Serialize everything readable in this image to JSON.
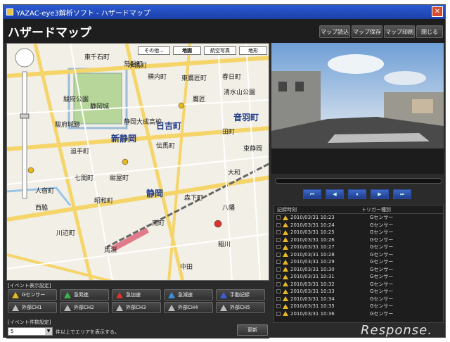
{
  "window": {
    "title": "YAZAC-eye3解析ソフト - ハザードマップ",
    "close_glyph": "✕"
  },
  "header": {
    "title": "ハザードマップ",
    "buttons": [
      "マップ読込",
      "マップ保存",
      "マップ印刷",
      "閉じる"
    ]
  },
  "map": {
    "tabs": [
      "その他...",
      "地図",
      "航空写真",
      "地形"
    ],
    "labels": {
      "a": "東千石町",
      "b": "水落町",
      "c": "横内町",
      "d": "東鷹匠町",
      "e": "春日町",
      "f": "静岡城",
      "g": "駿府公園",
      "h": "駿府城跡",
      "i": "静岡大成高校",
      "j": "新静岡",
      "k": "日吉町",
      "l": "音羽町",
      "m": "静岡",
      "n": "伝馬町",
      "o": "常磐町",
      "p": "昭和町",
      "q": "人宿町",
      "r": "紺屋町",
      "s": "南町",
      "t": "八幡",
      "u": "川辺町",
      "v": "西脇",
      "w": "森下町",
      "x": "中田",
      "y": "馬淵",
      "z": "稲川",
      "aa": "大和",
      "ab": "東静岡",
      "ac": "七間町",
      "ad": "追手町",
      "ae": "鷹匠",
      "af": "田町",
      "ag": "清水山公園"
    }
  },
  "video": {
    "controls": [
      "⏮",
      "◀",
      "⏸",
      "▶",
      "⏭"
    ]
  },
  "event_list": {
    "headers": [
      "記録時刻",
      "トリガー種別"
    ],
    "rows": [
      {
        "time": "2010/03/31 10:23",
        "trigger": "Gセンサー"
      },
      {
        "time": "2010/03/31 10:24",
        "trigger": "Gセンサー"
      },
      {
        "time": "2010/03/31 10:25",
        "trigger": "Gセンサー"
      },
      {
        "time": "2010/03/31 10:26",
        "trigger": "Gセンサー"
      },
      {
        "time": "2010/03/31 10:27",
        "trigger": "Gセンサー"
      },
      {
        "time": "2010/03/31 10:28",
        "trigger": "Gセンサー"
      },
      {
        "time": "2010/03/31 10:29",
        "trigger": "Gセンサー"
      },
      {
        "time": "2010/03/31 10:30",
        "trigger": "Gセンサー"
      },
      {
        "time": "2010/03/31 10:31",
        "trigger": "Gセンサー"
      },
      {
        "time": "2010/03/31 10:32",
        "trigger": "Gセンサー"
      },
      {
        "time": "2010/03/31 10:33",
        "trigger": "Gセンサー"
      },
      {
        "time": "2010/03/31 10:34",
        "trigger": "Gセンサー"
      },
      {
        "time": "2010/03/31 10:35",
        "trigger": "Gセンサー"
      },
      {
        "time": "2010/03/31 10:36",
        "trigger": "Gセンサー"
      }
    ]
  },
  "event_display": {
    "label": "[イベント表示設定]",
    "buttons": [
      {
        "label": "Gセンサー",
        "color": "#e6b820"
      },
      {
        "label": "急発進",
        "color": "#3ab54a"
      },
      {
        "label": "急加速",
        "color": "#d8332c"
      },
      {
        "label": "急減速",
        "color": "#3a8fd8"
      },
      {
        "label": "手動記録",
        "color": "#3a5fd8"
      },
      {
        "label": "外部CH1",
        "color": "#bbbbbb"
      },
      {
        "label": "外部CH2",
        "color": "#bbbbbb"
      },
      {
        "label": "外部CH3",
        "color": "#bbbbbb"
      },
      {
        "label": "外部CH4",
        "color": "#bbbbbb"
      },
      {
        "label": "外部CH5",
        "color": "#bbbbbb"
      }
    ]
  },
  "event_count": {
    "label": "[イベント件数設定]",
    "value": "5",
    "note": "件以上でエリアを表示する。",
    "update_button": "更新"
  },
  "watermark": "Response."
}
